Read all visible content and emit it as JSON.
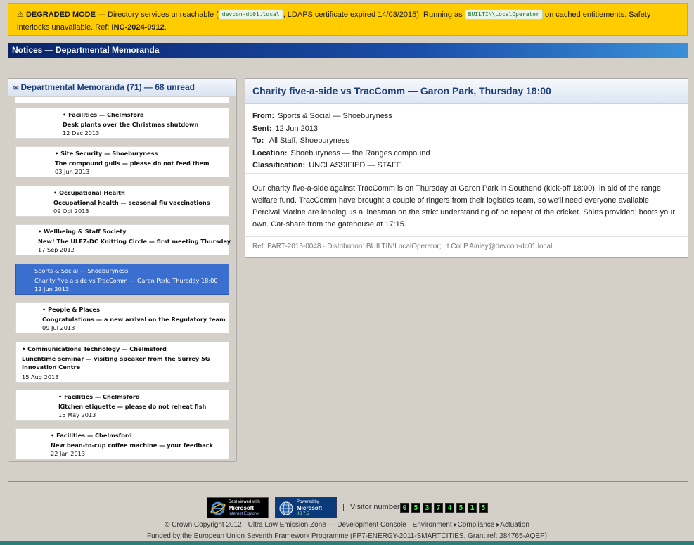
{
  "banner": {
    "icon": "warning-icon",
    "title": "DEGRADED MODE",
    "text1": " — Directory services unreachable (",
    "host": "devcon-dc01.local",
    "text2": ", LDAPS certificate expired 14/03/2015). Running as ",
    "account": "BUILTIN\\LocalOperator",
    "text3": " on cached entitlements. Safety interlocks unavailable. Ref: ",
    "ref": "INC-2024-0912",
    "text4": "."
  },
  "titlebar": "Notices — Departmental Memoranda",
  "list": {
    "header_icon": "mail-icon",
    "header": "Departmental Memoranda (71) — 68 unread",
    "items": [
      {
        "category": "Facilities — Chelmsford",
        "subject": "Desk plants over the Christmas shutdown",
        "date": "12 Dec 2013",
        "unread": true
      },
      {
        "category": "Site Security — Shoeburyness",
        "subject": "The compound gulls — please do not feed them",
        "date": "03 Jun 2013",
        "unread": true
      },
      {
        "category": "Occupational Health",
        "subject": "Occupational health — seasonal flu vaccinations",
        "date": "09 Oct 2013",
        "unread": true
      },
      {
        "category": "Wellbeing & Staff Society",
        "subject": "New! The ULEZ-DC Knitting Circle — first meeting Thursday",
        "date": "17 Sep 2012",
        "unread": true
      },
      {
        "category": "Sports & Social — Shoeburyness",
        "subject": "Charity five-a-side vs TracComm — Garon Park, Thursday 18:00",
        "date": "12 Jun 2013",
        "selected": true
      },
      {
        "category": "People & Places",
        "subject": "Congratulations — a new arrival on the Regulatory team",
        "date": "09 Jul 2013",
        "unread": true
      },
      {
        "category": "Communications Technology — Chelmsford",
        "subject": "Lunchtime seminar — visiting speaker from the Surrey 5G Innovation Centre",
        "date": "15 Aug 2013",
        "unread": true
      },
      {
        "category": "Facilities — Chelmsford",
        "subject": "Kitchen etiquette — please do not reheat fish",
        "date": "15 May 2013",
        "unread": true
      },
      {
        "category": "Facilities — Chelmsford",
        "subject": "New bean-to-cup coffee machine — your feedback",
        "date": "22 Jan 2013",
        "unread": true
      }
    ]
  },
  "message": {
    "title": "Charity five-a-side vs TracComm — Garon Park, Thursday 18:00",
    "from_label": "From:",
    "from": "Sports & Social — Shoeburyness",
    "sent_label": "Sent:",
    "sent": "12 Jun 2013",
    "to_label": "To:",
    "to": "All Staff, Shoeburyness",
    "location_label": "Location:",
    "location": "Shoeburyness — the Ranges compound",
    "classification_label": "Classification:",
    "classification": "UNCLASSIFIED — STAFF",
    "body": "Our charity five-a-side against TracComm is on Thursday at Garon Park in Southend (kick-off 18:00), in aid of the range welfare fund. TracComm have brought a couple of ringers from their logistics team, so we'll need everyone available. Percival Marine are lending us a linesman on the strict understanding of no repeat of the cricket. Shirts provided; boots your own. Car-share from the gatehouse at 17:15.",
    "ref": "Ref: PART-2013-0048 · Distribution: BUILTIN\\LocalOperator; Lt.Col.P.Ainley@devcon-dc01.local"
  },
  "footer": {
    "ie_badge": {
      "line1": "Best viewed with",
      "line2": "Microsoft",
      "line3": "Internet Explorer"
    },
    "iis_badge": {
      "line1": "Powered by",
      "line2": "Microsoft",
      "line3": "IIS 7.5"
    },
    "separator": "|",
    "visitor_label": "Visitor number:",
    "visitor_digits": [
      "0",
      "5",
      "3",
      "7",
      "4",
      "5",
      "1",
      "5"
    ],
    "copyright": "© Crown Copyright 2012 · Ultra Low Emission Zone — Development Console · Environment",
    "link_compliance": "Compliance",
    "link_actuation": "Actuation",
    "funding": "Funded by the European Union Seventh Framework Programme (FP7-ENERGY-2011-SMARTCITIES, Grant ref: 284765-AQEP)"
  }
}
